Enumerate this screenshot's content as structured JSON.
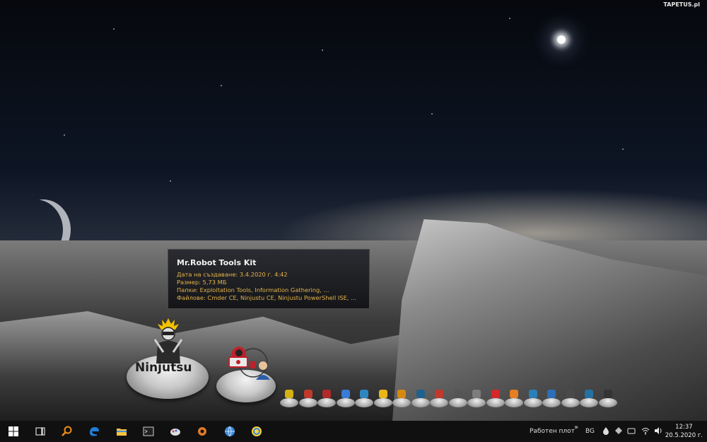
{
  "wallpaper": {
    "brand": "TAPETUS.pl"
  },
  "tooltip": {
    "title": "Mr.Robot Tools Kit",
    "lines": [
      "Дата на създаване: 3.4.2020 г. 4:42",
      "Размер: 5,73 МБ",
      "Папки: Exploitation Tools, Information Gathering, ...",
      "Файлове: Cmder CE, Ninjustu CE, Ninjustu PowerShell ISE, ..."
    ]
  },
  "desktop_icons": {
    "ninjutsu_label": "Ninjutsu"
  },
  "dock": {
    "items": [
      {
        "name": "joystick-icon",
        "color": "#d4b012"
      },
      {
        "name": "radar-icon",
        "color": "#c0392b"
      },
      {
        "name": "camera-icon",
        "color": "#b22a2a"
      },
      {
        "name": "phone-icon",
        "color": "#3a7bd5"
      },
      {
        "name": "network-icon",
        "color": "#2e86c1"
      },
      {
        "name": "doc-lock-icon",
        "color": "#e8b717"
      },
      {
        "name": "folder-tools-icon",
        "color": "#d68910"
      },
      {
        "name": "target-icon",
        "color": "#1f618d"
      },
      {
        "name": "bug-icon",
        "color": "#c0392b"
      },
      {
        "name": "router-icon",
        "color": "#555555"
      },
      {
        "name": "qr-icon",
        "color": "#7d7d7d"
      },
      {
        "name": "wifi-icon",
        "color": "#d62828"
      },
      {
        "name": "star-tools-icon",
        "color": "#e67e22"
      },
      {
        "name": "monitor-icon",
        "color": "#2980b9"
      },
      {
        "name": "browser-window-icon",
        "color": "#2c6fb8"
      },
      {
        "name": "cd-icon",
        "color": "#4a4a4a"
      },
      {
        "name": "globe-icon",
        "color": "#2471a3"
      },
      {
        "name": "trash-icon",
        "color": "#333333"
      }
    ]
  },
  "taskbar": {
    "pinned": [
      {
        "name": "start-button",
        "icon": "windows-icon"
      },
      {
        "name": "task-view-button",
        "icon": "task-view-icon"
      },
      {
        "name": "search-app-button",
        "icon": "magnifier-icon",
        "color": "#f08c1a"
      },
      {
        "name": "edge-button",
        "icon": "edge-icon",
        "color": "#1f7fd6"
      },
      {
        "name": "file-explorer-button",
        "icon": "folder-icon",
        "color": "#f5c342"
      },
      {
        "name": "terminal-button",
        "icon": "terminal-icon",
        "color": "#cccccc"
      },
      {
        "name": "paint-button",
        "icon": "paint-icon",
        "color": "#c94c4c"
      },
      {
        "name": "gear-app-button",
        "icon": "gear-icon",
        "color": "#e07b2a"
      },
      {
        "name": "globe-app-button",
        "icon": "globe-icon",
        "color": "#3d8bd8"
      },
      {
        "name": "refresh-app-button",
        "icon": "refresh-icon",
        "color": "#2f86d6"
      }
    ],
    "desktop_label": "Работен плот",
    "chevron": "»",
    "language": "BG",
    "time": "12:37",
    "date": "20.5.2020 г."
  }
}
